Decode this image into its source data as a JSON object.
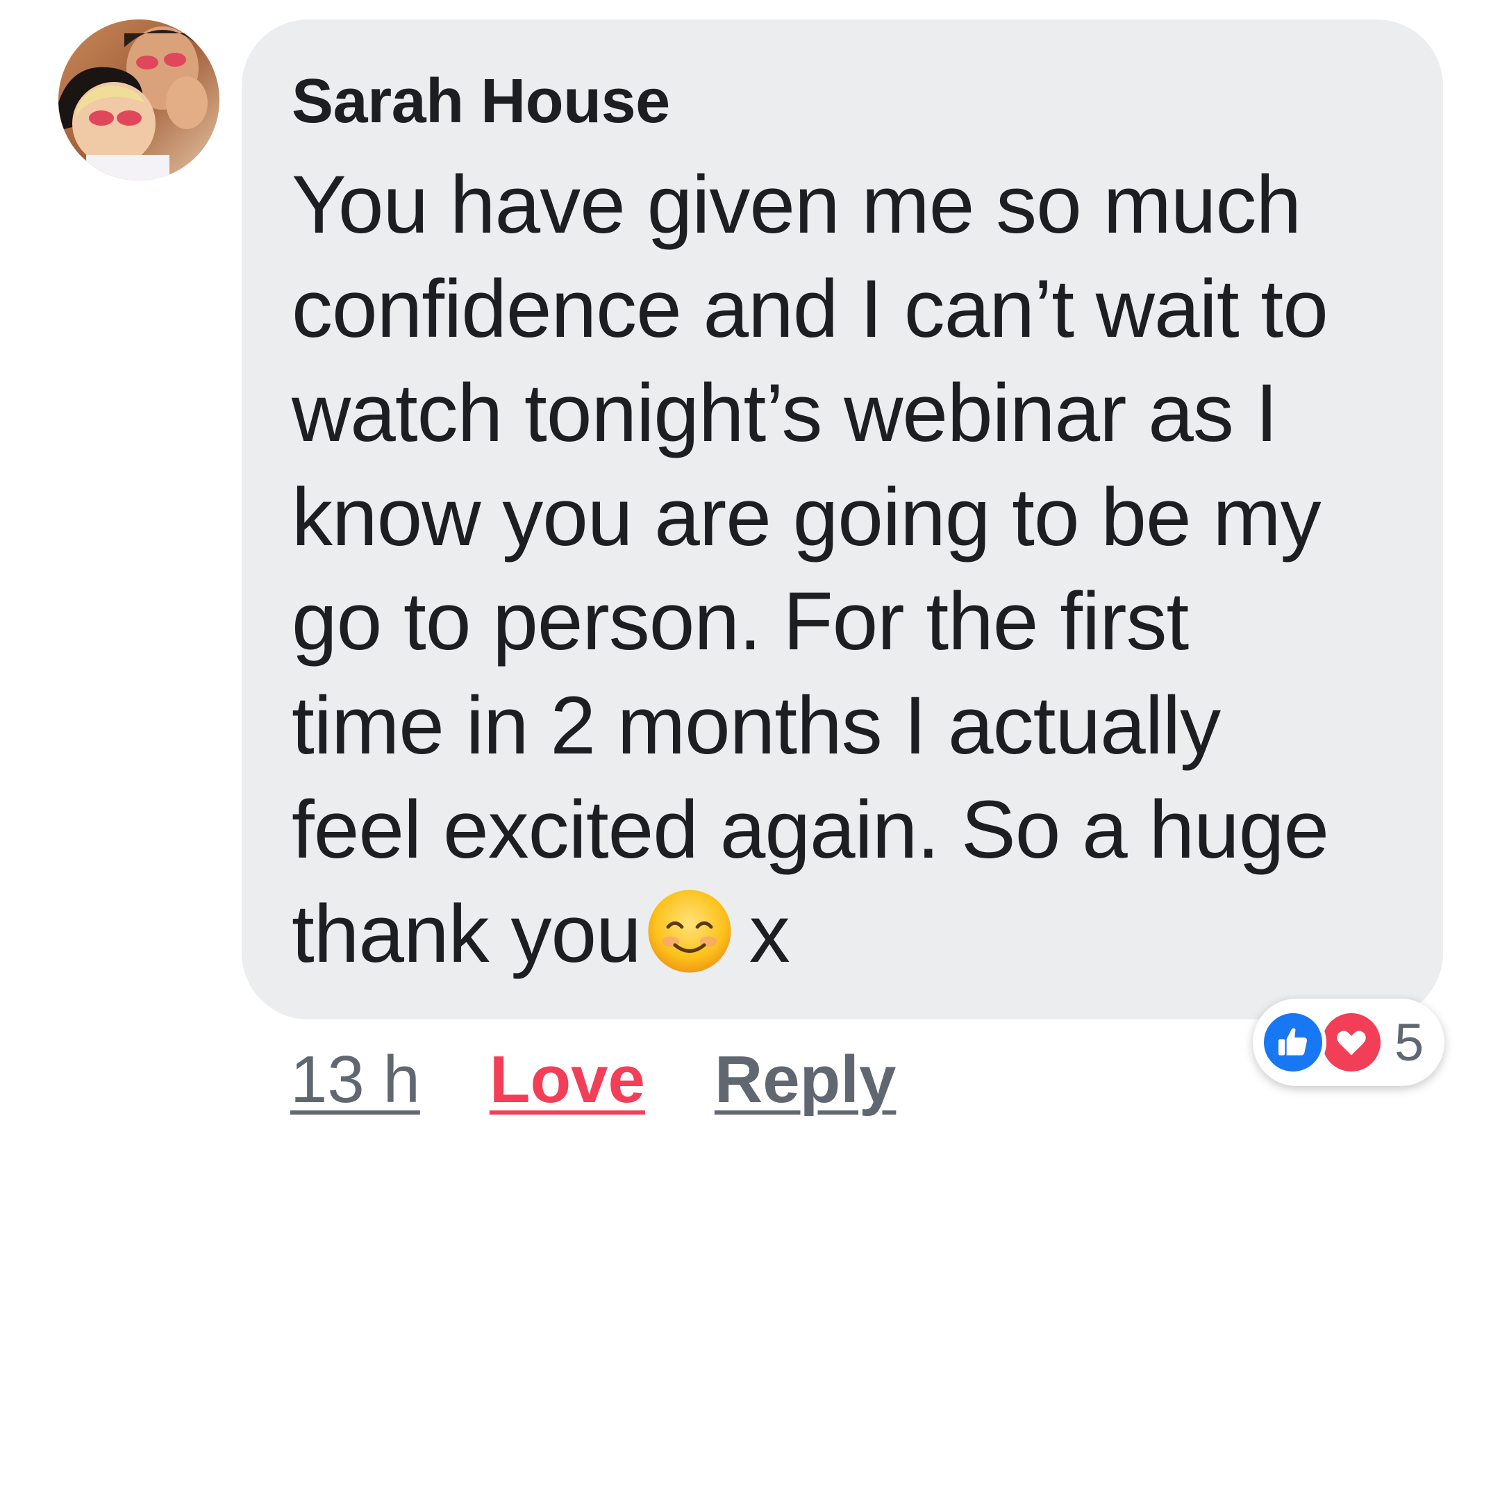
{
  "comment": {
    "author": "Sarah House",
    "text_before_emoji": "You have given me so much\nconfidence and I can’t wait to\nwatch tonight’s webinar as I\nknow you are going to be my\ngo to person. For the first\ntime in 2 months I actually\nfeel excited again. So a huge\nthank you",
    "emoji": "smiling-face-with-smiling-eyes",
    "text_after_emoji": "x",
    "bubble_color": "#ebedef"
  },
  "actions": {
    "time": "13 h",
    "love": "Love",
    "reply": "Reply",
    "love_color": "#f33e58"
  },
  "reactions": {
    "icons": [
      "like-icon",
      "love-icon"
    ],
    "count": "5",
    "like_color": "#1877f2",
    "love_color": "#f33e58"
  }
}
